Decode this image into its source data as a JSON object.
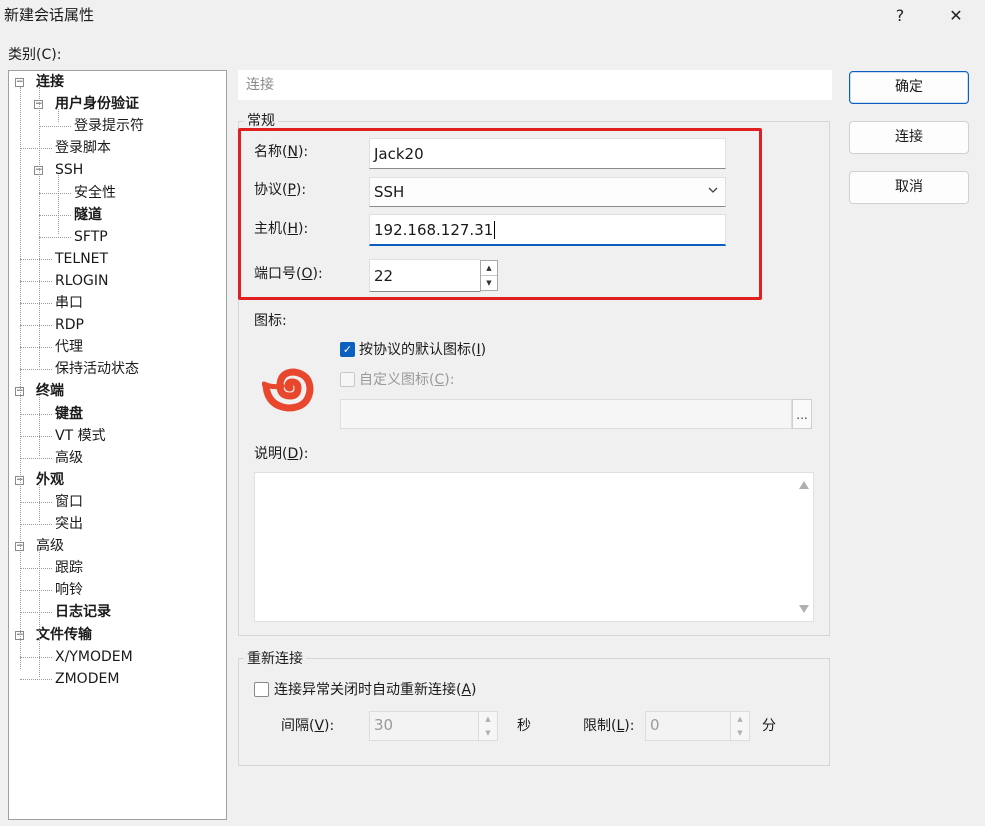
{
  "window": {
    "title": "新建会话属性",
    "help_label": "?",
    "close_label": "✕"
  },
  "category_label": "类别(C):",
  "category_hotkey": "C",
  "tree": [
    {
      "label": "连接",
      "bold": true
    },
    {
      "label": "用户身份验证",
      "bold": true
    },
    {
      "label": "登录提示符",
      "bold": false
    },
    {
      "label": "登录脚本",
      "bold": false
    },
    {
      "label": "SSH",
      "bold": false
    },
    {
      "label": "安全性",
      "bold": false
    },
    {
      "label": "隧道",
      "bold": true
    },
    {
      "label": "SFTP",
      "bold": false
    },
    {
      "label": "TELNET",
      "bold": false
    },
    {
      "label": "RLOGIN",
      "bold": false
    },
    {
      "label": "串口",
      "bold": false
    },
    {
      "label": "RDP",
      "bold": false
    },
    {
      "label": "代理",
      "bold": false
    },
    {
      "label": "保持活动状态",
      "bold": false
    },
    {
      "label": "终端",
      "bold": true
    },
    {
      "label": "键盘",
      "bold": true
    },
    {
      "label": "VT 模式",
      "bold": false
    },
    {
      "label": "高级",
      "bold": false
    },
    {
      "label": "外观",
      "bold": true
    },
    {
      "label": "窗口",
      "bold": false
    },
    {
      "label": "突出",
      "bold": false
    },
    {
      "label": "高级",
      "bold": false
    },
    {
      "label": "跟踪",
      "bold": false
    },
    {
      "label": "响铃",
      "bold": false
    },
    {
      "label": "日志记录",
      "bold": true
    },
    {
      "label": "文件传输",
      "bold": true
    },
    {
      "label": "X/YMODEM",
      "bold": false
    },
    {
      "label": "ZMODEM",
      "bold": false
    }
  ],
  "path_label": "连接",
  "general": {
    "group_title": "常规",
    "name_label_pre": "名称(",
    "name_hotkey": "N",
    "name_label_post": "):",
    "name_value": "Jack20",
    "protocol_label_pre": "协议(",
    "protocol_hotkey": "P",
    "protocol_label_post": "):",
    "protocol_value": "SSH",
    "host_label_pre": "主机(",
    "host_hotkey": "H",
    "host_label_post": "):",
    "host_value": "192.168.127.31",
    "port_label_pre": "端口号(",
    "port_hotkey": "O",
    "port_label_post": "):",
    "port_value": "22",
    "icon_label": "图标:",
    "default_icon_pre": "按协议的默认图标(",
    "default_icon_hotkey": "I",
    "default_icon_post": ")",
    "default_icon_checked": true,
    "custom_icon_pre": "自定义图标(",
    "custom_icon_hotkey": "C",
    "custom_icon_post": "):",
    "custom_icon_checked": false,
    "browse_label": "...",
    "desc_label_pre": "说明(",
    "desc_hotkey": "D",
    "desc_label_post": "):",
    "desc_value": ""
  },
  "reconnect": {
    "group_title": "重新连接",
    "auto_pre": "连接异常关闭时自动重新连接(",
    "auto_hotkey": "A",
    "auto_post": ")",
    "auto_checked": false,
    "interval_pre": "间隔(",
    "interval_hotkey": "V",
    "interval_post": "):",
    "interval_value": "30",
    "interval_unit": "秒",
    "limit_pre": "限制(",
    "limit_hotkey": "L",
    "limit_post": "):",
    "limit_value": "0",
    "limit_unit": "分"
  },
  "buttons": {
    "ok": "确定",
    "connect": "连接",
    "cancel": "取消"
  },
  "colors": {
    "accent": "#0a5fbf",
    "highlight_box": "#e02020",
    "icon_red": "#e8472d"
  },
  "icons": {
    "session_icon": "swirl-shell-icon"
  }
}
